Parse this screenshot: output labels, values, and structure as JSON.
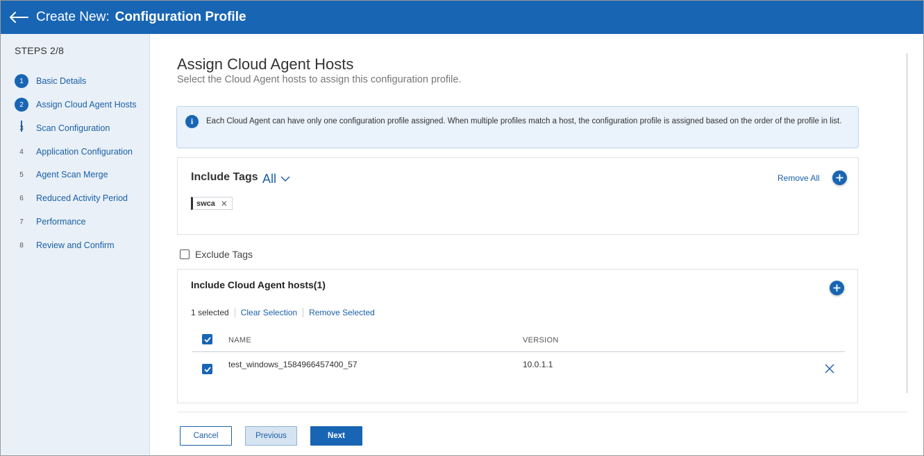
{
  "header": {
    "title_prefix": "Create New:",
    "title_main": "Configuration Profile"
  },
  "sidebar": {
    "steps_label": "STEPS 2/8",
    "steps": [
      {
        "num": "1",
        "label": "Basic Details",
        "state": "done"
      },
      {
        "num": "2",
        "label": "Assign Cloud Agent Hosts",
        "state": "active"
      },
      {
        "num": "3",
        "label": "Scan Configuration",
        "state": "pending"
      },
      {
        "num": "4",
        "label": "Application Configuration",
        "state": "pending"
      },
      {
        "num": "5",
        "label": "Agent Scan Merge",
        "state": "pending"
      },
      {
        "num": "6",
        "label": "Reduced Activity Period",
        "state": "pending"
      },
      {
        "num": "7",
        "label": "Performance",
        "state": "pending"
      },
      {
        "num": "8",
        "label": "Review and Confirm",
        "state": "pending"
      }
    ]
  },
  "main": {
    "title": "Assign Cloud Agent Hosts",
    "subtitle": "Select the Cloud Agent hosts to assign this configuration profile.",
    "info_text": "Each Cloud Agent can have only one configuration profile assigned. When multiple profiles match a host, the configuration profile is assigned based on the order of the profile in list.",
    "include_tags": {
      "title": "Include Tags",
      "match_mode": "All",
      "remove_all_label": "Remove All",
      "tags": [
        "swca"
      ]
    },
    "exclude_tags": {
      "label": "Exclude Tags",
      "checked": false
    },
    "hosts": {
      "title": "Include Cloud Agent hosts(1)",
      "selected_count": "1 selected",
      "clear_selection_label": "Clear Selection",
      "remove_selected_label": "Remove Selected",
      "columns": [
        "NAME",
        "VERSION"
      ],
      "rows": [
        {
          "name": "test_windows_1584966457400_57",
          "version": "10.0.1.1",
          "checked": true
        }
      ]
    }
  },
  "footer": {
    "cancel_label": "Cancel",
    "previous_label": "Previous",
    "next_label": "Next"
  },
  "colors": {
    "brand": "#1865b4",
    "sidebar_bg": "#e9f0f7",
    "info_bg": "#eaf2fb",
    "link": "#1a5fa8"
  }
}
